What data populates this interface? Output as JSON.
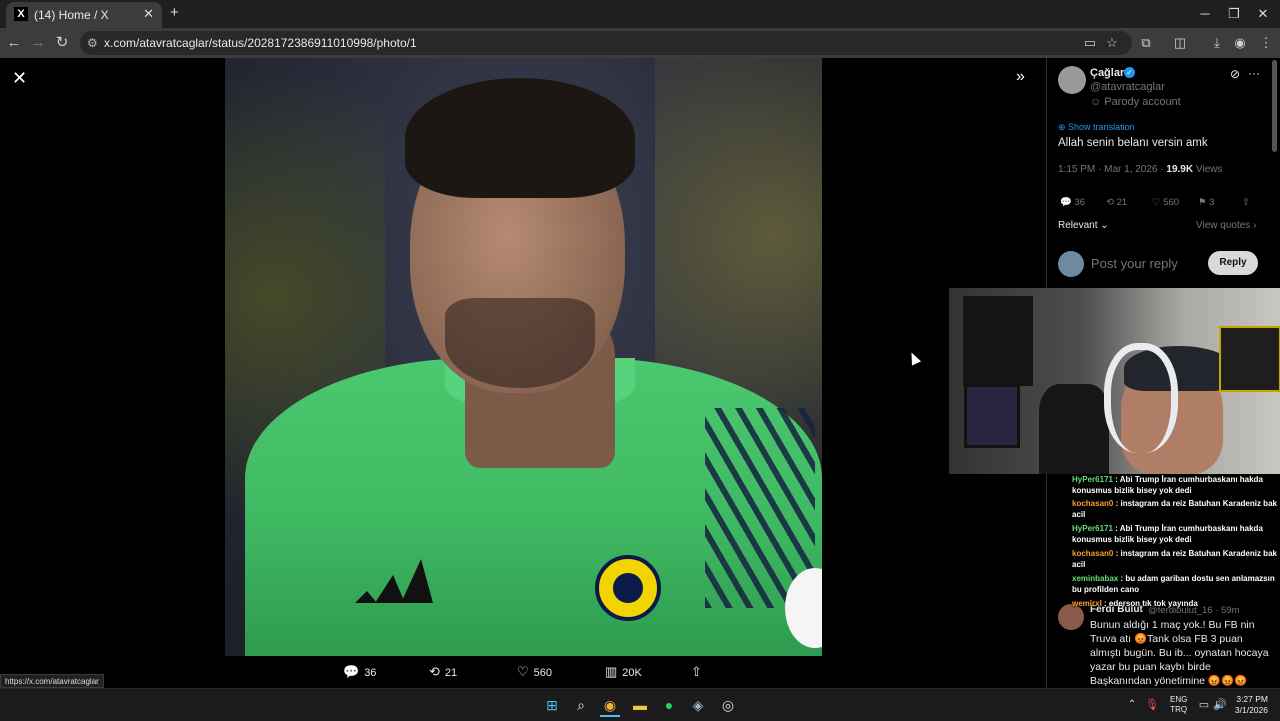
{
  "browser": {
    "tab_title": "(14) Home / X",
    "tab_favicon": "X",
    "url": "x.com/atavratcaglar/status/2028172386911010998/photo/1",
    "status_url": "https://x.com/atavratcaglar"
  },
  "viewer": {
    "actions": {
      "replies": "36",
      "reposts": "21",
      "likes": "560",
      "views": "20K"
    }
  },
  "tweet": {
    "author_name": "Çağlar",
    "handle": "@atavratcaglar",
    "parody_label": "Parody account",
    "show_translation": "Show translation",
    "text": "Allah senin belanı versin amk",
    "time": "1:15 PM · Mar 1, 2026 · ",
    "views_count": "19.9K",
    "views_label": " Views",
    "replies": "36",
    "reposts": "21",
    "likes": "560",
    "bookmarks": "3",
    "sort_label": "Relevant",
    "view_quotes": "View quotes"
  },
  "reply_box": {
    "placeholder": "Post your reply",
    "button": "Reply"
  },
  "reply": {
    "name": "Ferdi Bulut",
    "handle": "@ferdibulut_16 · 59m",
    "text": "Bunun aldığı 1 maç yok.! Bu FB nin Truva atı 😡Tank olsa FB 3 puan almıştı bugün. Bu ib... oynatan hocaya yazar bu puan kaybı birde Başkanından yönetimine 😡😡😡"
  },
  "chat": [
    {
      "user": "HyPer6171",
      "msg": ": Abi Trump İran cumhurbaskanı hakda konusmus bizlik bisey yok dedi",
      "color": "green"
    },
    {
      "user": "kochasan0",
      "msg": ": instagram da reiz Batuhan Karadeniz bak acil",
      "color": "orange"
    },
    {
      "user": "HyPer6171",
      "msg": ": Abi Trump İran cumhurbaskanı hakda konusmus bizlik bisey yok dedi",
      "color": "green"
    },
    {
      "user": "kochasan0",
      "msg": ": instagram da reiz Batuhan Karadeniz bak acil",
      "color": "orange"
    },
    {
      "user": "xeminbabax",
      "msg": ": bu adam gariban dostu sen anlamazsın bu profilden cano",
      "color": "green"
    },
    {
      "user": "wemirxl",
      "msg": ": ederson tık tok yayında",
      "color": "orange"
    }
  ],
  "taskbar": {
    "lang_top": "ENG",
    "lang_bottom": "TRQ",
    "time": "3:27 PM",
    "date": "3/1/2026"
  },
  "colors": {
    "accent": "#1d9bf0",
    "jersey": "#3fb862",
    "chat_user_green": "#62e07c",
    "chat_user_orange": "#ff9b2e"
  },
  "icons": [
    "x-logo-icon",
    "close-icon",
    "expand-icon",
    "reply-icon",
    "repost-icon",
    "like-icon",
    "views-icon",
    "share-icon",
    "bookmark-icon",
    "verified-icon",
    "grok-icon",
    "more-icon",
    "translate-icon"
  ]
}
